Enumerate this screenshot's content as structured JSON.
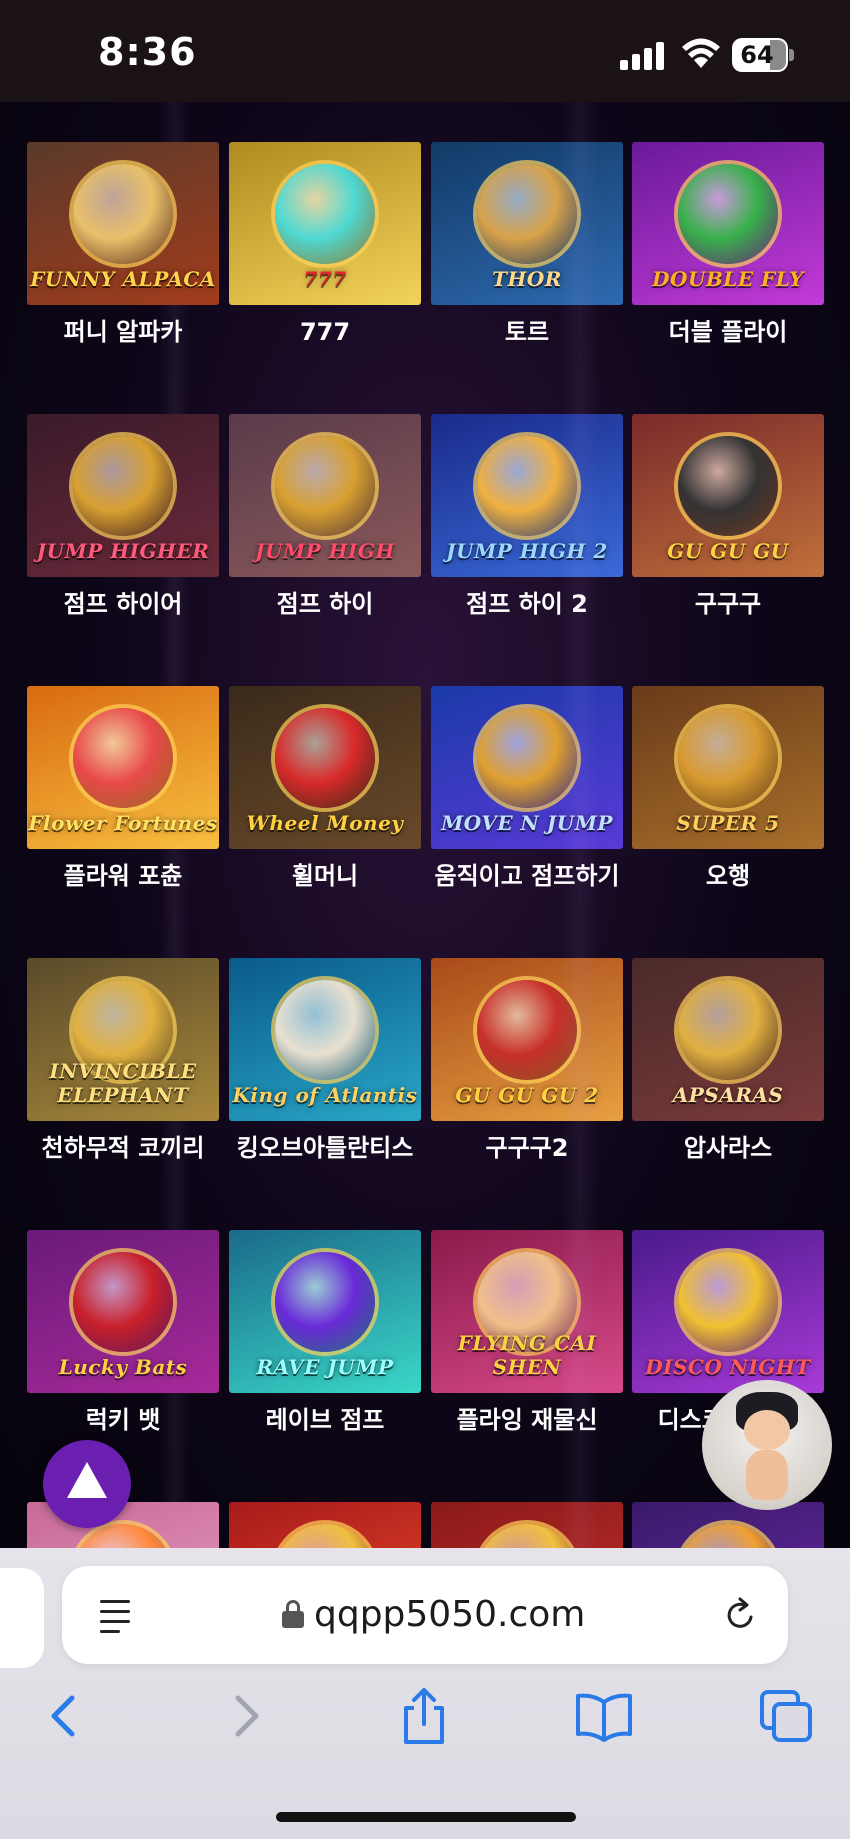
{
  "status_bar": {
    "time": "8:36",
    "battery": "64"
  },
  "games": [
    {
      "name": "퍼니 알파카",
      "logo": "FUNNY ALPACA",
      "colors": [
        "#5a3a2a",
        "#a33c1c"
      ],
      "emblem": "#e8c06a",
      "logo_color": "#ffd34a"
    },
    {
      "name": "777",
      "logo": "777",
      "colors": [
        "#b08a20",
        "#f2d35a"
      ],
      "emblem": "#4fd8d2",
      "logo_color": "#e0262a"
    },
    {
      "name": "토르",
      "logo": "THOR",
      "colors": [
        "#123a66",
        "#2e6ab0"
      ],
      "emblem": "#d8a24a",
      "logo_color": "#ffd88a"
    },
    {
      "name": "더블 플라이",
      "logo": "DOUBLE FLY",
      "colors": [
        "#6a1a9a",
        "#c33ad8"
      ],
      "emblem": "#38b04a",
      "logo_color": "#ffb020"
    },
    {
      "name": "점프 하이어",
      "logo": "JUMP HIGHER",
      "colors": [
        "#3a1a2a",
        "#6a2a3a"
      ],
      "emblem": "#d8a030",
      "logo_color": "#ff5a7a"
    },
    {
      "name": "점프 하이",
      "logo": "JUMP HIGH",
      "colors": [
        "#5a3a4a",
        "#8a5a5a"
      ],
      "emblem": "#d8a030",
      "logo_color": "#ff4a6a"
    },
    {
      "name": "점프 하이 2",
      "logo": "JUMP HIGH 2",
      "colors": [
        "#1a2a8a",
        "#3a6ad8"
      ],
      "emblem": "#f0b040",
      "logo_color": "#9ad8ff"
    },
    {
      "name": "구구구",
      "logo": "GU GU GU",
      "colors": [
        "#7a2a2a",
        "#c0703a"
      ],
      "emblem": "#333333",
      "logo_color": "#ffd040"
    },
    {
      "name": "플라워 포츈",
      "logo": "Flower Fortunes",
      "colors": [
        "#d86a10",
        "#f8c040"
      ],
      "emblem": "#e84a4a",
      "logo_color": "#ffe060"
    },
    {
      "name": "휠머니",
      "logo": "Wheel Money",
      "colors": [
        "#3a2a1a",
        "#6a4a2a"
      ],
      "emblem": "#d82a2a",
      "logo_color": "#ffd040"
    },
    {
      "name": "움직이고 점프하기",
      "logo": "MOVE N JUMP",
      "colors": [
        "#1a3aa8",
        "#5a3ad8"
      ],
      "emblem": "#e0a030",
      "logo_color": "#c0e0ff"
    },
    {
      "name": "오행",
      "logo": "SUPER 5",
      "colors": [
        "#6a3a1a",
        "#a8702a"
      ],
      "emblem": "#d89a30",
      "logo_color": "#ffd060"
    },
    {
      "name": "천하무적 코끼리",
      "logo": "INVINCIBLE ELEPHANT",
      "colors": [
        "#5a4a2a",
        "#a8883a"
      ],
      "emblem": "#e0b040",
      "logo_color": "#ffe080"
    },
    {
      "name": "킹오브아틀란티스",
      "logo": "King of Atlantis",
      "colors": [
        "#0a5a8a",
        "#2aa8c8"
      ],
      "emblem": "#e8e0d0",
      "logo_color": "#ffd060"
    },
    {
      "name": "구구구2",
      "logo": "GU GU GU 2",
      "colors": [
        "#a84a1a",
        "#e8a040"
      ],
      "emblem": "#c8302a",
      "logo_color": "#ffd040"
    },
    {
      "name": "압사라스",
      "logo": "APSARAS",
      "colors": [
        "#4a2a2a",
        "#7a3a3a"
      ],
      "emblem": "#e0b040",
      "logo_color": "#ffe0a0"
    },
    {
      "name": "럭키 뱃",
      "logo": "Lucky Bats",
      "colors": [
        "#6a1a7a",
        "#a82a9a"
      ],
      "emblem": "#c8202a",
      "logo_color": "#ffd040"
    },
    {
      "name": "레이브 점프",
      "logo": "RAVE JUMP",
      "colors": [
        "#1a6a8a",
        "#3ad8c8"
      ],
      "emblem": "#6a2ad8",
      "logo_color": "#9affff"
    },
    {
      "name": "플라잉 재물신",
      "logo": "FLYING CAI SHEN",
      "colors": [
        "#8a1a4a",
        "#d84a8a"
      ],
      "emblem": "#f0c08a",
      "logo_color": "#ffd040"
    },
    {
      "name": "디스코 나이트",
      "logo": "DISCO NIGHT",
      "colors": [
        "#4a1a8a",
        "#a83ad8"
      ],
      "emblem": "#f0c030",
      "logo_color": "#ff5a5a"
    },
    {
      "name": "",
      "logo": "",
      "colors": [
        "#c86a9a",
        "#e8a0c0"
      ],
      "emblem": "#ff8a3a",
      "logo_color": "#ffffff"
    },
    {
      "name": "",
      "logo": "",
      "colors": [
        "#a81a1a",
        "#e84a2a"
      ],
      "emblem": "#f0c040",
      "logo_color": "#ffffff"
    },
    {
      "name": "",
      "logo": "",
      "colors": [
        "#8a1a1a",
        "#c8302a"
      ],
      "emblem": "#f0c040",
      "logo_color": "#ffffff"
    },
    {
      "name": "",
      "logo": "",
      "colors": [
        "#3a1a6a",
        "#6a2aa8"
      ],
      "emblem": "#f0a030",
      "logo_color": "#ffffff"
    }
  ],
  "address_bar": {
    "url": "qqpp5050.com"
  },
  "toolbar": {
    "accent": "#2a7ae8",
    "disabled": "#a0a4b0",
    "items": [
      "back-icon",
      "forward-icon",
      "share-icon",
      "bookmarks-icon",
      "tabs-icon"
    ]
  }
}
